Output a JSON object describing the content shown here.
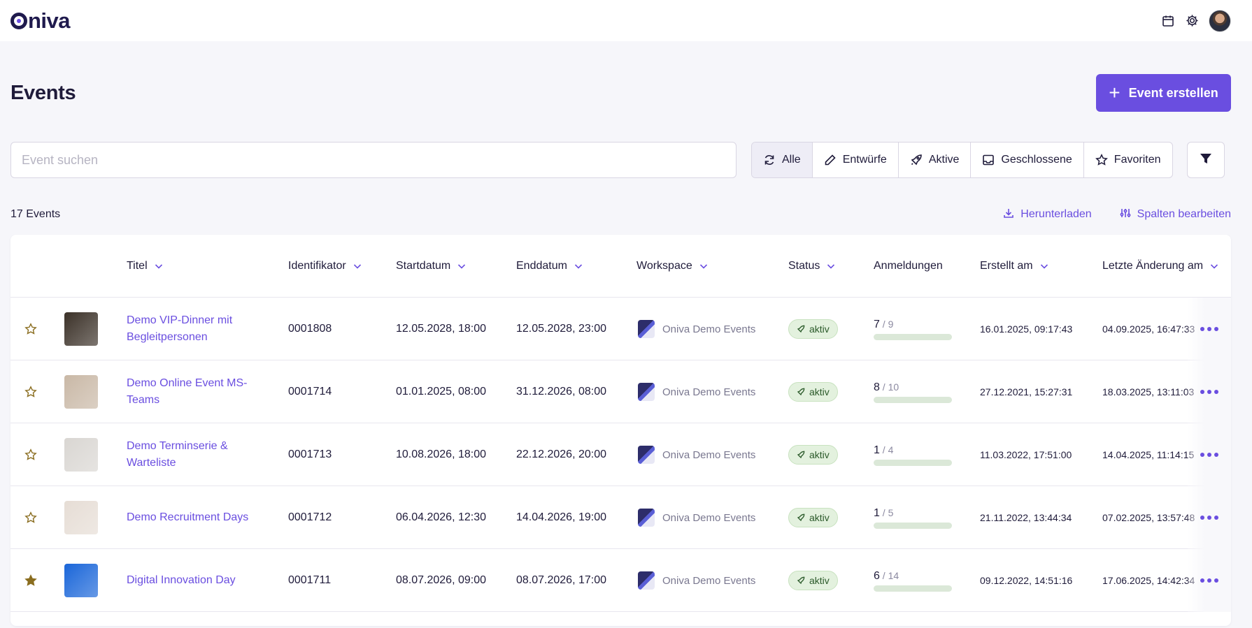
{
  "brand": {
    "name": "niva"
  },
  "page": {
    "title": "Events",
    "create_label": "Event erstellen"
  },
  "search": {
    "placeholder": "Event suchen"
  },
  "filters": [
    {
      "label": "Alle",
      "icon": "refresh-icon",
      "active": true
    },
    {
      "label": "Entwürfe",
      "icon": "pencil-icon",
      "active": false
    },
    {
      "label": "Aktive",
      "icon": "rocket-icon",
      "active": false
    },
    {
      "label": "Geschlossene",
      "icon": "inbox-icon",
      "active": false
    },
    {
      "label": "Favoriten",
      "icon": "star-icon",
      "active": false
    }
  ],
  "meta": {
    "count": "17 Events",
    "download": "Herunterladen",
    "edit_columns": "Spalten bearbeiten"
  },
  "columns": [
    "Titel",
    "Identifikator",
    "Startdatum",
    "Enddatum",
    "Workspace",
    "Status",
    "Anmeldungen",
    "Erstellt am",
    "Letzte Änderung am"
  ],
  "rows": [
    {
      "favorite": false,
      "title": "Demo VIP-Dinner mit Begleitpersonen",
      "id": "0001808",
      "start": "12.05.2028, 18:00",
      "end": "12.05.2028, 23:00",
      "workspace": "Oniva Demo Events",
      "status": "aktiv",
      "reg_count": "7",
      "reg_total": " / 9",
      "reg_ratio": 0.778,
      "created": "16.01.2025, 09:17:43",
      "modified": "04.09.2025, 16:47:33",
      "thumb": "#3b3128"
    },
    {
      "favorite": false,
      "title": "Demo Online Event MS-Teams",
      "id": "0001714",
      "start": "01.01.2025, 08:00",
      "end": "31.12.2026, 08:00",
      "workspace": "Oniva Demo Events",
      "status": "aktiv",
      "reg_count": "8",
      "reg_total": " / 10",
      "reg_ratio": 0.8,
      "created": "27.12.2021, 15:27:31",
      "modified": "18.03.2025, 13:11:03",
      "thumb": "#c9b8a6"
    },
    {
      "favorite": false,
      "title": "Demo Terminserie & Warteliste",
      "id": "0001713",
      "start": "10.08.2026, 18:00",
      "end": "22.12.2026, 20:00",
      "workspace": "Oniva Demo Events",
      "status": "aktiv",
      "reg_count": "1",
      "reg_total": " / 4",
      "reg_ratio": 0.25,
      "created": "11.03.2022, 17:51:00",
      "modified": "14.04.2025, 11:14:15",
      "thumb": "#d9d6d2"
    },
    {
      "favorite": false,
      "title": "Demo Recruitment Days",
      "id": "0001712",
      "start": "06.04.2026, 12:30",
      "end": "14.04.2026, 19:00",
      "workspace": "Oniva Demo Events",
      "status": "aktiv",
      "reg_count": "1",
      "reg_total": " / 5",
      "reg_ratio": 0.2,
      "created": "21.11.2022, 13:44:34",
      "modified": "07.02.2025, 13:57:48",
      "thumb": "#e6ddd5"
    },
    {
      "favorite": true,
      "title": "Digital Innovation Day",
      "id": "0001711",
      "start": "08.07.2026, 09:00",
      "end": "08.07.2026, 17:00",
      "workspace": "Oniva Demo Events",
      "status": "aktiv",
      "reg_count": "6",
      "reg_total": " / 14",
      "reg_ratio": 0.43,
      "created": "09.12.2022, 14:51:16",
      "modified": "17.06.2025, 14:42:34",
      "thumb": "#1a66d9"
    }
  ],
  "colors": {
    "accent": "#6a4ee0",
    "success": "#3f8a42",
    "favorite": "#8a6d1f"
  }
}
